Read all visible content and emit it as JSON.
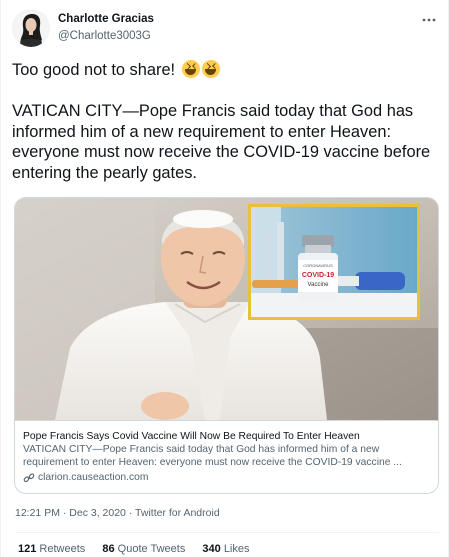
{
  "author": {
    "name": "Charlotte Gracias",
    "handle": "@Charlotte3003G"
  },
  "tweet": {
    "intro": "Too good not to share!",
    "body": "VATICAN CITY—Pope Francis said today that God has informed him of a new requirement to enter Heaven: everyone must now receive the COVID-19 vaccine before entering the pearly gates."
  },
  "card": {
    "inset_label": "COVID-19",
    "inset_sublabel": "Vaccine",
    "title": "Pope Francis Says Covid Vaccine Will Now Be Required To Enter Heaven",
    "description": "VATICAN CITY—Pope Francis said today that God has informed him of a new requirement to enter Heaven: everyone must now receive the COVID-19 vaccine ...",
    "domain": "clarion.causeaction.com"
  },
  "meta": {
    "timestamp": "12:21 PM · Dec 3, 2020 · Twitter for Android"
  },
  "stats": {
    "retweets_count": "121",
    "retweets_label": "Retweets",
    "quotes_count": "86",
    "quotes_label": "Quote Tweets",
    "likes_count": "340",
    "likes_label": "Likes"
  },
  "icons": [
    "more-options-icon",
    "laughing-emoji-icon",
    "link-icon"
  ],
  "colors": {
    "text": "#0f1419",
    "secondary": "#536471",
    "border": "#cfd9de",
    "inset_frame": "#e8c13a",
    "emoji": "#ffcc4d"
  }
}
